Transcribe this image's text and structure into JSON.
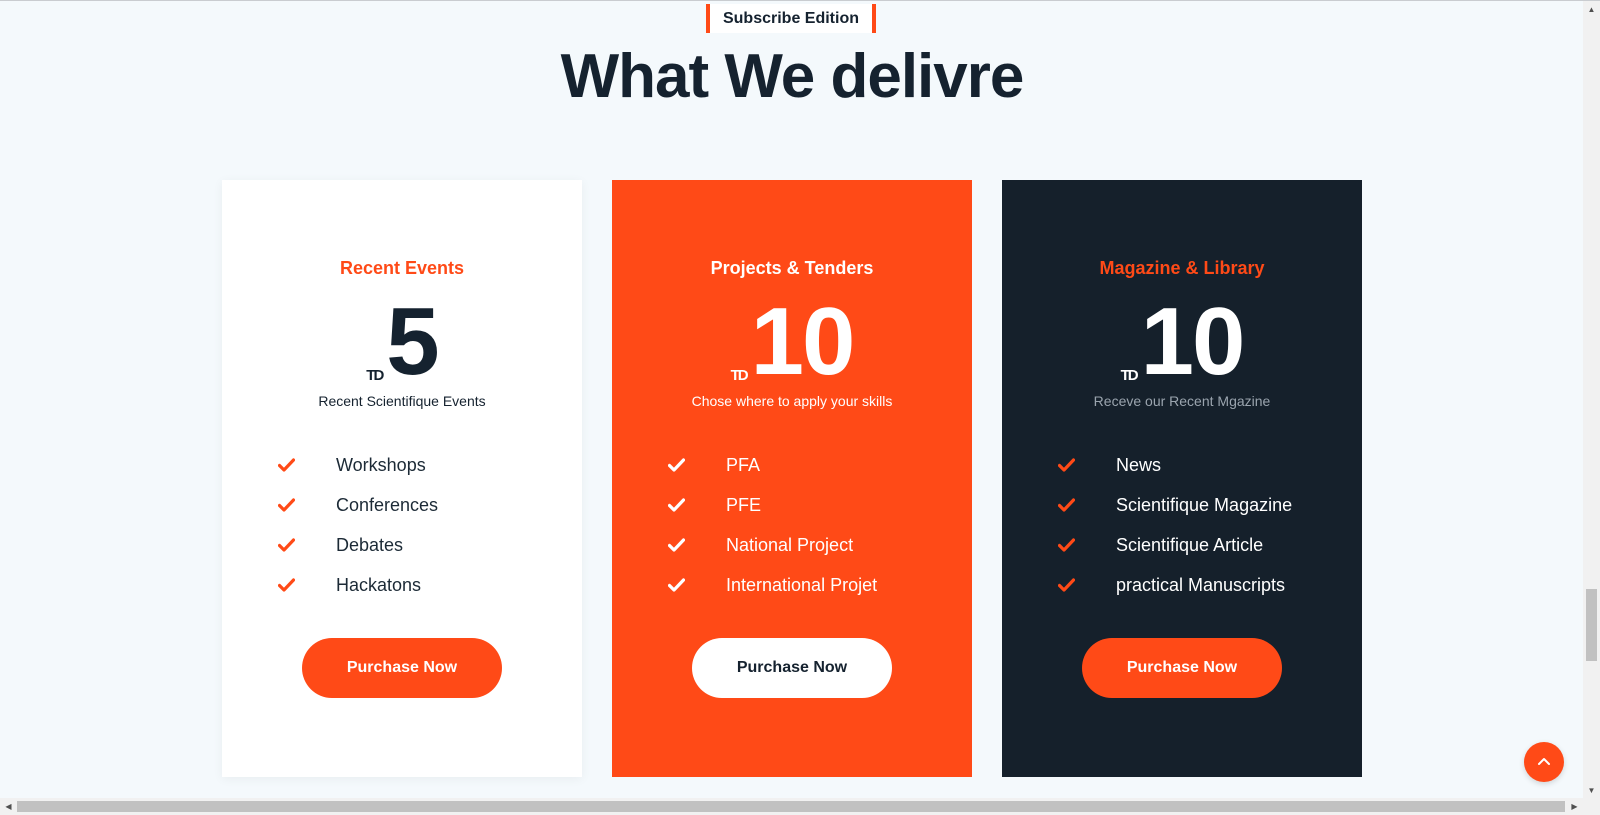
{
  "section": {
    "eyebrow": "Subscribe Edition",
    "title": "What We delivre"
  },
  "cards": [
    {
      "title": "Recent Events",
      "currency": "TD",
      "amount": "5",
      "subtitle": "Recent Scientifique Events",
      "features": [
        "Workshops",
        "Conferences",
        "Debates",
        "Hackatons"
      ],
      "button": "Purchase Now"
    },
    {
      "title": "Projects & Tenders",
      "currency": "TD",
      "amount": "10",
      "subtitle": "Chose where to apply your skills",
      "features": [
        "PFA",
        "PFE",
        "National Project",
        "International Projet"
      ],
      "button": "Purchase Now"
    },
    {
      "title": "Magazine & Library",
      "currency": "TD",
      "amount": "10",
      "subtitle": "Receve our Recent Mgazine",
      "features": [
        "News",
        "Scientifique Magazine",
        "Scientifique Article",
        "practical Manuscripts"
      ],
      "button": "Purchase Now"
    }
  ],
  "icons": {
    "feature": "check-icon",
    "back_to_top": "chevron-up-icon"
  },
  "colors": {
    "accent": "#ff4a17",
    "dark": "#15202b",
    "background": "#f4f9fc"
  }
}
